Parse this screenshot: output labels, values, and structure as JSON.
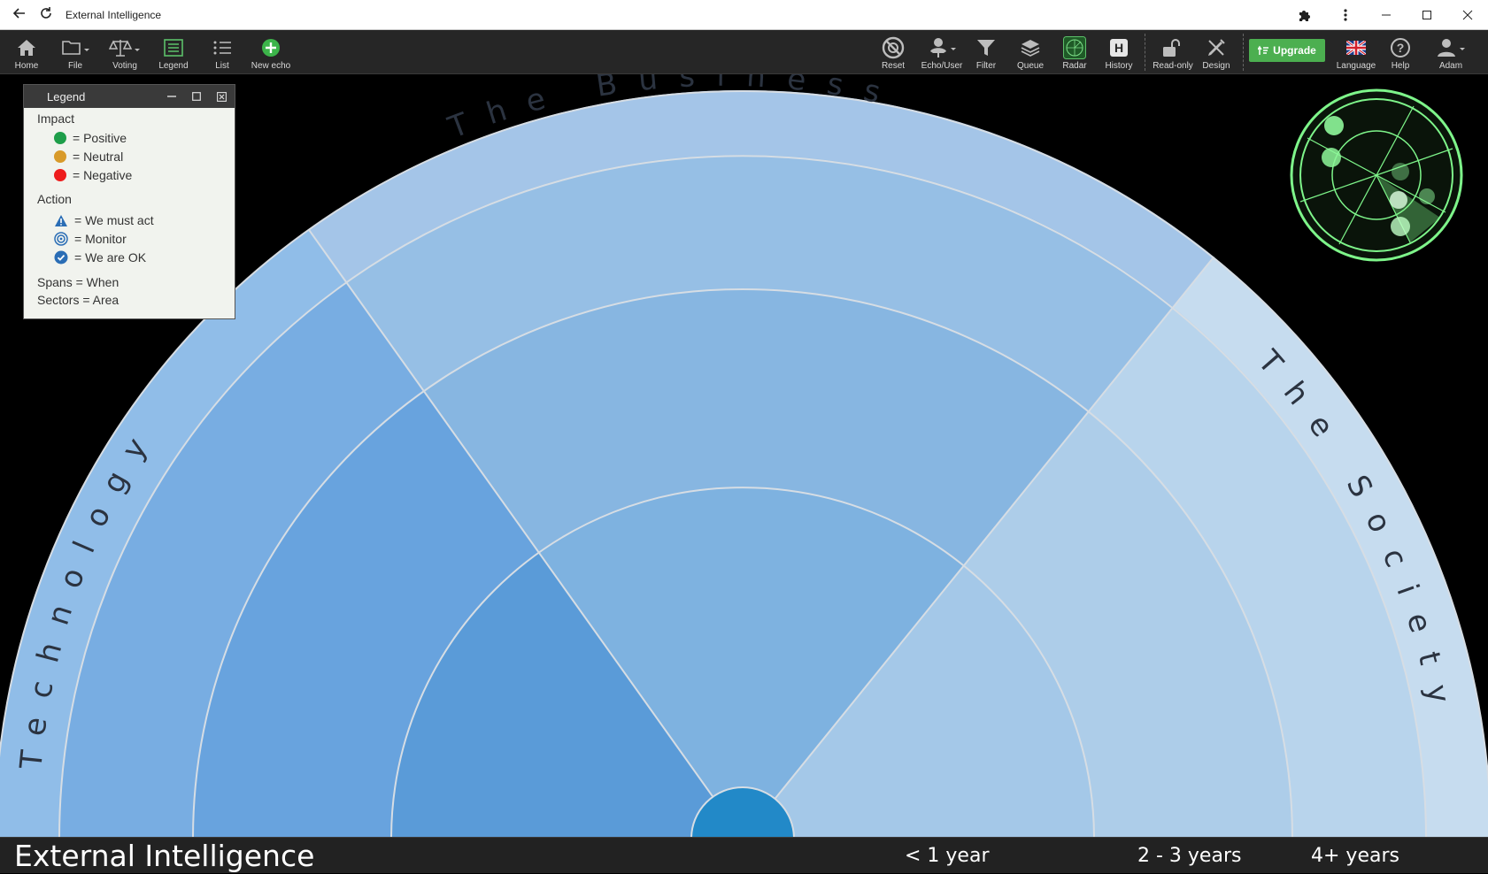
{
  "window": {
    "title": "External Intelligence"
  },
  "toolbar": {
    "home": "Home",
    "file": "File",
    "voting": "Voting",
    "legend": "Legend",
    "list": "List",
    "new_echo": "New echo",
    "reset": "Reset",
    "echo_user": "Echo/User",
    "filter": "Filter",
    "queue": "Queue",
    "radar": "Radar",
    "history": "History",
    "read_only": "Read-only",
    "design": "Design",
    "upgrade": "Upgrade",
    "language": "Language",
    "help": "Help",
    "user": "Adam"
  },
  "legend": {
    "title": "Legend",
    "impact_heading": "Impact",
    "impact": [
      {
        "label": "= Positive",
        "color": "#1e9e4a"
      },
      {
        "label": "= Neutral",
        "color": "#d89a2a"
      },
      {
        "label": "= Negative",
        "color": "#ee1c1c"
      }
    ],
    "action_heading": "Action",
    "action": [
      {
        "label": "= We must act",
        "icon": "warning-triangle-icon"
      },
      {
        "label": "= Monitor",
        "icon": "target-icon"
      },
      {
        "label": "= We are OK",
        "icon": "check-circle-icon"
      }
    ],
    "spans": "Spans = When",
    "sectors": "Sectors = Area"
  },
  "radar": {
    "sectors": [
      {
        "label": "Technology",
        "color_inner": "#5a9bd8",
        "color_mid": "#68a3de",
        "color_outer": "#78ade2",
        "color_band": "#90bde8"
      },
      {
        "label": "The Business",
        "color_inner": "#7eb2e0",
        "color_mid": "#87b6e1",
        "color_outer": "#96bfe5",
        "color_band": "#a4c5e8"
      },
      {
        "label": "The Society",
        "color_inner": "#a4c8e8",
        "color_mid": "#adcde9",
        "color_outer": "#b8d4ec",
        "color_band": "#c6dcef"
      }
    ],
    "center_color": "#2289c8"
  },
  "footer": {
    "title": "External Intelligence",
    "spans": [
      "< 1 year",
      "2 - 3 years",
      "4+ years"
    ]
  },
  "colors": {
    "accent": "#4caf50",
    "toolbar_bg": "#262626",
    "background": "#000000"
  }
}
